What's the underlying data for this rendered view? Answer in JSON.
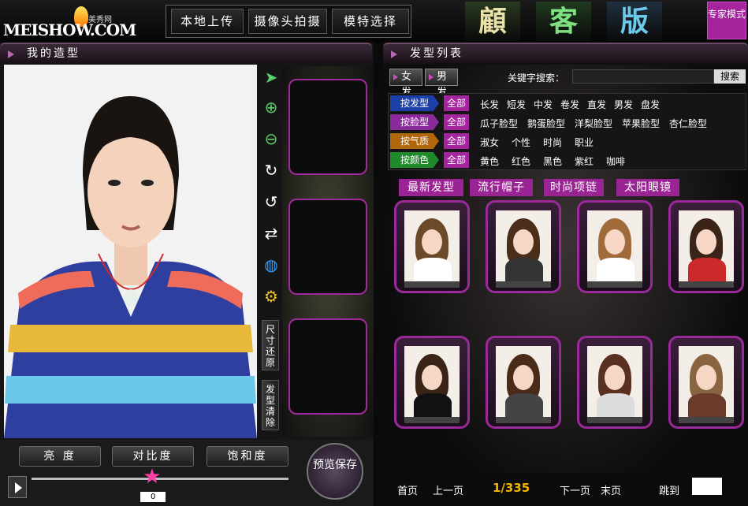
{
  "header": {
    "logo_text": "MEISHOW.COM",
    "logo_subtext": "美秀网",
    "buttons": [
      "本地上传",
      "摄像头拍摄",
      "模特选择"
    ],
    "mode_title": [
      "顧",
      "客",
      "版"
    ],
    "expert_mode": "专家模式"
  },
  "left_panel": {
    "title": "我的造型",
    "tools": [
      "pointer-icon",
      "zoom-in-icon",
      "zoom-out-icon",
      "rotate-cw-icon",
      "rotate-ccw-icon",
      "flip-icon",
      "globe-icon",
      "gear-icon"
    ],
    "size_reset": "尺寸还原",
    "hair_clear": "发型清除",
    "adjust_buttons": [
      "亮 度",
      "对比度",
      "饱和度"
    ],
    "preview_save": "预览保存",
    "slider_value": "0",
    "slider_level": 0.47
  },
  "right_panel": {
    "title": "发型列表",
    "gender_tabs": [
      "女发",
      "男发"
    ],
    "keyword_label": "关键字搜索：",
    "search_button": "搜索",
    "filters": [
      {
        "label": "按发型",
        "color": "#1d3fa8",
        "all": "全部",
        "options": [
          "长发",
          "短发",
          "中发",
          "卷发",
          "直发",
          "男发",
          "盘发"
        ]
      },
      {
        "label": "按脸型",
        "color": "#8a2a9a",
        "all": "全部",
        "options": [
          "瓜子脸型",
          "鹅蛋脸型",
          "洋梨脸型",
          "苹果脸型",
          "杏仁脸型"
        ]
      },
      {
        "label": "按气质",
        "color": "#b0660a",
        "all": "全部",
        "options": [
          "淑女",
          "个性",
          "时尚",
          "职业"
        ]
      },
      {
        "label": "按颜色",
        "color": "#1f8a2a",
        "all": "全部",
        "options": [
          "黄色",
          "红色",
          "黑色",
          "紫红",
          "咖啡"
        ]
      }
    ],
    "category_tabs": [
      "最新发型",
      "流行帽子",
      "时尚项链",
      "太阳眼镜"
    ],
    "hair_colors": [
      "#6b4a2a",
      "#4a2e1a",
      "#a06a3a",
      "#3a2418",
      "#3a2418",
      "#4a2a18",
      "#5a3020",
      "#8a6440"
    ],
    "pager": {
      "first": "首页",
      "prev": "上一页",
      "page_info": "1/335",
      "next": "下一页",
      "last": "末页",
      "jump": "跳到"
    }
  }
}
